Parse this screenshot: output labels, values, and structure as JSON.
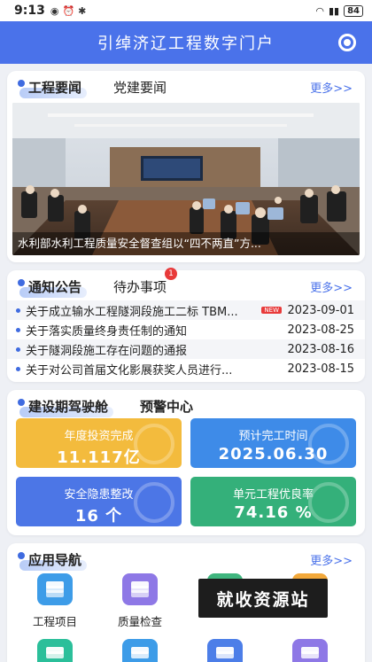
{
  "status": {
    "time": "9:13",
    "battery": "84"
  },
  "appbar": {
    "title": "引绰济辽工程数字门户"
  },
  "news": {
    "tabs": [
      "工程要闻",
      "党建要闻"
    ],
    "more": "更多>>",
    "caption": "水利部水利工程质量安全督查组以“四不两直”方..."
  },
  "notices": {
    "tabs": [
      "通知公告",
      "待办事项"
    ],
    "todo_badge": "1",
    "more": "更多>>",
    "new_label": "NEW",
    "items": [
      {
        "title": "关于成立输水工程隧洞段施工二标 TBM...",
        "date": "2023-09-01",
        "is_new": true
      },
      {
        "title": "关于落实质量终身责任制的通知",
        "date": "2023-08-25"
      },
      {
        "title": "关于隧洞段施工存在问题的通报",
        "date": "2023-08-16"
      },
      {
        "title": "关于对公司首届文化影展获奖人员进行...",
        "date": "2023-08-15"
      }
    ]
  },
  "cockpit": {
    "tabs": [
      "建设期驾驶舱",
      "预警中心"
    ],
    "tiles": [
      {
        "label": "年度投资完成",
        "value": "11.117亿",
        "color": "#f3bb3d"
      },
      {
        "label": "预计完工时间",
        "value": "2025.06.30",
        "color": "#3e8be8"
      },
      {
        "label": "安全隐患整改",
        "value": "16 个",
        "color": "#4c76e6"
      },
      {
        "label": "单元工程优良率",
        "value": "74.16 %",
        "color": "#34b07a"
      }
    ]
  },
  "nav": {
    "tab": "应用导航",
    "more": "更多>>",
    "items": [
      {
        "label": "工程项目",
        "color": "#3d9ce8"
      },
      {
        "label": "质量检查",
        "color": "#8e78e6"
      }
    ],
    "second_row_colors": [
      "#2bbf9a",
      "#3d9ce8",
      "#4c7ee8",
      "#8e78e6"
    ]
  },
  "watermark": {
    "text": "就收资源站"
  }
}
